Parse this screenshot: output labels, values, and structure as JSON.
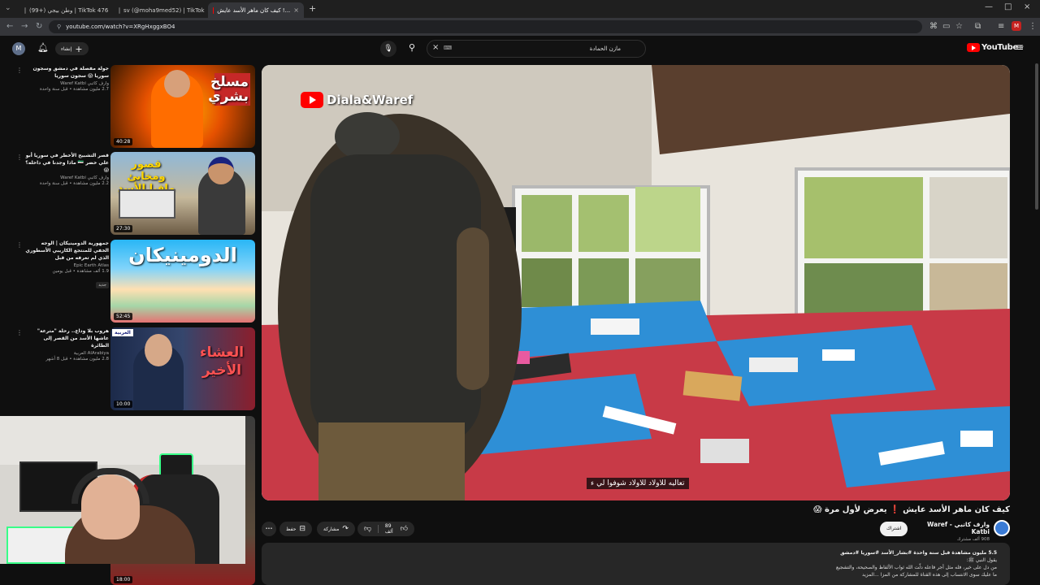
{
  "browser": {
    "tabs": [
      {
        "label": "(99+) وطن بيجي | TikTok 476",
        "favicon_color": "#000000"
      },
      {
        "label": "sv (@moha9med52) | TikTok",
        "favicon_color": "#000000"
      },
      {
        "label": "كيف كان ماهر الأسد عايش !...",
        "favicon_color": "#ff0000"
      }
    ],
    "url": "youtube.com/watch?v=XRgHxggxBO4"
  },
  "header": {
    "avatar_letter": "M",
    "create_label": "إنشاء",
    "search_value": "مازن الحمادة",
    "logo_text": "YouTube",
    "logo_region": "SY"
  },
  "recommendations": [
    {
      "title": "جولة مفصلة في دمشق وسجون سوريا 😱 سجون سوريا",
      "channel": "وارف كاتبي Waref Katbi",
      "views": "2.7 مليون مشاهدة • قبل سنة واحدة",
      "duration": "40:28",
      "thumb_text": "مسلخ بشري"
    },
    {
      "title": "قصر التشبيح الأخطر في سوريا أبو علي خضر 🇸🇾 ماذا وجدنا في داخله؟ 😱",
      "channel": "وارف كاتبي Waref Katbi",
      "views": "2.2 مليون مشاهدة • قبل سنة واحدة",
      "duration": "27:30",
      "thumb_text": "قصور ومخابئ مافيا الأسد"
    },
    {
      "title": "جمهورية الدومينيكان | الوجه الخفي للمنتجع الكاريبي الأسطوري الذي لم تعرفه من قبل",
      "channel": "Epic Earth Atlas",
      "views": "1.9 ألف مشاهدة • قبل يومين",
      "duration": "52:45",
      "thumb_text": "الدومينيكان",
      "badge": "جديد"
    },
    {
      "title": "هروب بلا وداع.. رحلة \"مترعة\" عاشها الأسد من القصر إلى الطائرة",
      "channel": "AlArabiya العربية",
      "views": "2.8 مليون مشاهدة • قبل 8 أشهر",
      "duration": "10:00",
      "thumb_text": "العشاء الأخير",
      "thumb_logo": "العربية"
    },
    {
      "duration": "18:00"
    }
  ],
  "player": {
    "watermark": "Diala&Waref",
    "subtitle": "تعاليه للاولاد للاولاد شوفوا لي ء"
  },
  "video": {
    "title": "كيف كان ماهر الأسد عايش ❗ يعرض لأول مرة 😱",
    "channel": "وارف كاتبي - Waref Katbi",
    "subscribers": "908 ألف مشترك",
    "subscribe_label": "اشتراك",
    "likes": "89 ألف",
    "share_label": "مشاركة",
    "save_label": "حفظ",
    "more_label": "•••"
  },
  "description": {
    "stats": "5.5 مليون مشاهدة  قبل سنة واحدة  #بشار_الأسد #سوريا #دمشق",
    "line1": "يقول النبي ﷺ:",
    "line2": "من دل على خير، فله مثل أجر فاعله دلّت الله ثواب الألفاظ والصحيحة، والتشجيع",
    "line3": "ما عليك سوى الانتساب إلى هذه القناة للمشاركة من المزا ...المزيد"
  },
  "colors": {
    "accent": "#ff0000",
    "background": "#0f0f0f",
    "pill": "#272727"
  }
}
